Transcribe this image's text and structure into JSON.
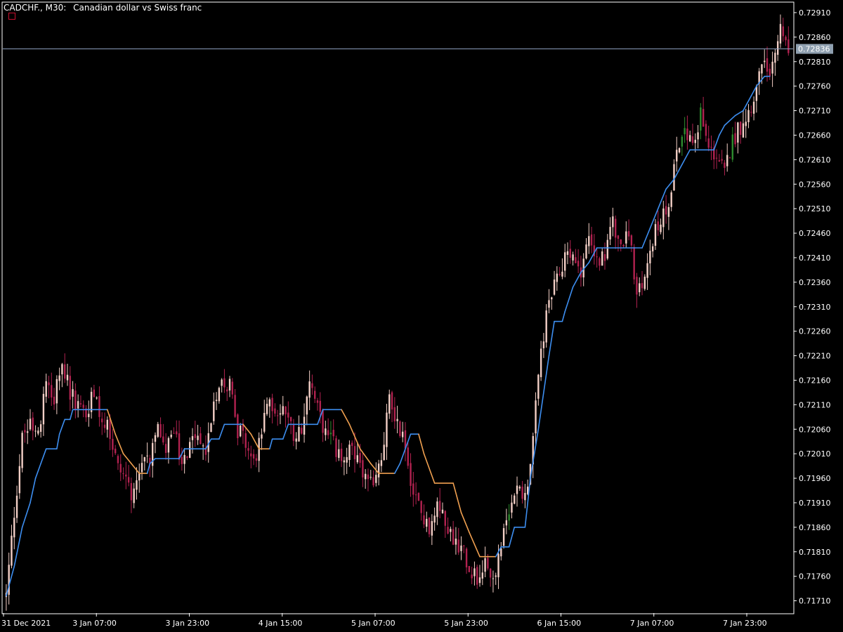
{
  "header": {
    "symbol": "CADCHF., M30:",
    "description": "Canadian dollar vs Swiss franc"
  },
  "colors": {
    "background": "#000000",
    "axis": "#ffffff",
    "text": "#ffffff",
    "bull_candle": "#f3cfc6",
    "bear_candle": "#b22250",
    "bull_candle_alt": "#2e8b2e",
    "trail_up": "#3d8ef0",
    "trail_down": "#f0a050",
    "price_line": "#8fa0c0",
    "price_label_bg": "#8fa0b0",
    "marker": "#c8102e"
  },
  "icons": {
    "marker": "square-icon"
  },
  "current_price": {
    "value": 0.72836,
    "label": "0.72836"
  },
  "chart_data": {
    "type": "candlestick",
    "title": "CADCHF., M30:  Canadian dollar vs Swiss franc",
    "ylim": [
      0.71685,
      0.7293
    ],
    "y_ticks": [
      "0.72910",
      "0.72860",
      "0.72810",
      "0.72760",
      "0.72710",
      "0.72660",
      "0.72610",
      "0.72560",
      "0.72510",
      "0.72460",
      "0.72410",
      "0.72360",
      "0.72310",
      "0.72260",
      "0.72210",
      "0.72160",
      "0.72110",
      "0.72060",
      "0.72010",
      "0.71960",
      "0.71910",
      "0.71860",
      "0.71810",
      "0.71760",
      "0.71710"
    ],
    "x_ticks": [
      "31 Dec 2021",
      "3 Jan 07:00",
      "3 Jan 23:00",
      "4 Jan 15:00",
      "5 Jan 07:00",
      "5 Jan 23:00",
      "6 Jan 15:00",
      "7 Jan 07:00",
      "7 Jan 23:00"
    ],
    "close_path": [
      [
        0,
        0.7172
      ],
      [
        3,
        0.7189
      ],
      [
        6,
        0.7204
      ],
      [
        9,
        0.7208
      ],
      [
        12,
        0.7206
      ],
      [
        15,
        0.7215
      ],
      [
        18,
        0.7213
      ],
      [
        21,
        0.7219
      ],
      [
        24,
        0.7214
      ],
      [
        27,
        0.7211
      ],
      [
        30,
        0.7209
      ],
      [
        33,
        0.7214
      ],
      [
        36,
        0.7208
      ],
      [
        39,
        0.7205
      ],
      [
        42,
        0.7198
      ],
      [
        45,
        0.7196
      ],
      [
        48,
        0.7192
      ],
      [
        51,
        0.7198
      ],
      [
        54,
        0.72
      ],
      [
        57,
        0.7206
      ],
      [
        60,
        0.7203
      ],
      [
        63,
        0.7205
      ],
      [
        66,
        0.7199
      ],
      [
        69,
        0.7202
      ],
      [
        72,
        0.7204
      ],
      [
        75,
        0.7201
      ],
      [
        78,
        0.7212
      ],
      [
        81,
        0.7217
      ],
      [
        84,
        0.7215
      ],
      [
        87,
        0.7206
      ],
      [
        90,
        0.7203
      ],
      [
        93,
        0.7199
      ],
      [
        96,
        0.7205
      ],
      [
        99,
        0.7213
      ],
      [
        102,
        0.7209
      ],
      [
        105,
        0.721
      ],
      [
        108,
        0.7205
      ],
      [
        111,
        0.7207
      ],
      [
        114,
        0.7216
      ],
      [
        117,
        0.721
      ],
      [
        120,
        0.7205
      ],
      [
        123,
        0.7203
      ],
      [
        126,
        0.7199
      ],
      [
        129,
        0.7202
      ],
      [
        132,
        0.7199
      ],
      [
        135,
        0.7196
      ],
      [
        138,
        0.7194
      ],
      [
        141,
        0.72
      ],
      [
        144,
        0.7212
      ],
      [
        147,
        0.7207
      ],
      [
        150,
        0.7203
      ],
      [
        153,
        0.7193
      ],
      [
        156,
        0.7189
      ],
      [
        159,
        0.7185
      ],
      [
        162,
        0.7192
      ],
      [
        165,
        0.7188
      ],
      [
        168,
        0.7184
      ],
      [
        171,
        0.7182
      ],
      [
        174,
        0.7178
      ],
      [
        177,
        0.7176
      ],
      [
        180,
        0.718
      ],
      [
        183,
        0.7174
      ],
      [
        186,
        0.7183
      ],
      [
        189,
        0.7188
      ],
      [
        192,
        0.7196
      ],
      [
        195,
        0.7192
      ],
      [
        198,
        0.7204
      ],
      [
        201,
        0.7222
      ],
      [
        204,
        0.7232
      ],
      [
        207,
        0.7236
      ],
      [
        210,
        0.7242
      ],
      [
        213,
        0.7241
      ],
      [
        216,
        0.7238
      ],
      [
        219,
        0.7246
      ],
      [
        222,
        0.724
      ],
      [
        225,
        0.7241
      ],
      [
        228,
        0.7248
      ],
      [
        231,
        0.7244
      ],
      [
        234,
        0.7247
      ],
      [
        237,
        0.7233
      ],
      [
        240,
        0.7236
      ],
      [
        243,
        0.7245
      ],
      [
        246,
        0.7248
      ],
      [
        249,
        0.7252
      ],
      [
        252,
        0.7264
      ],
      [
        255,
        0.7267
      ],
      [
        258,
        0.7264
      ],
      [
        261,
        0.727
      ],
      [
        264,
        0.7263
      ],
      [
        267,
        0.7262
      ],
      [
        270,
        0.7258
      ],
      [
        273,
        0.7265
      ],
      [
        276,
        0.7268
      ],
      [
        279,
        0.7271
      ],
      [
        282,
        0.7276
      ],
      [
        285,
        0.7281
      ],
      [
        288,
        0.7279
      ],
      [
        291,
        0.7288
      ],
      [
        294,
        0.72836
      ]
    ],
    "trail_path": [
      [
        0,
        0.7172
      ],
      [
        3,
        0.7178
      ],
      [
        6,
        0.7186
      ],
      [
        9,
        0.7191
      ],
      [
        11,
        0.7196
      ],
      [
        13,
        0.7199
      ],
      [
        15,
        0.7202
      ],
      [
        19,
        0.7202
      ],
      [
        20,
        0.7205
      ],
      [
        22,
        0.7208
      ],
      [
        24,
        0.7208
      ],
      [
        25,
        0.721
      ],
      [
        38,
        0.721
      ],
      [
        41,
        0.7205
      ],
      [
        44,
        0.7201
      ],
      [
        47,
        0.7199
      ],
      [
        50,
        0.7197
      ],
      [
        53,
        0.7197
      ],
      [
        54,
        0.7199
      ],
      [
        56,
        0.72
      ],
      [
        65,
        0.72
      ],
      [
        67,
        0.7202
      ],
      [
        75,
        0.7202
      ],
      [
        77,
        0.7204
      ],
      [
        80,
        0.7204
      ],
      [
        82,
        0.7207
      ],
      [
        89,
        0.7207
      ],
      [
        92,
        0.7205
      ],
      [
        95,
        0.7202
      ],
      [
        99,
        0.7202
      ],
      [
        100,
        0.7204
      ],
      [
        104,
        0.7204
      ],
      [
        106,
        0.7207
      ],
      [
        117,
        0.7207
      ],
      [
        119,
        0.721
      ],
      [
        126,
        0.721
      ],
      [
        129,
        0.7207
      ],
      [
        133,
        0.7202
      ],
      [
        137,
        0.7199
      ],
      [
        140,
        0.7197
      ],
      [
        146,
        0.7197
      ],
      [
        148,
        0.7199
      ],
      [
        150,
        0.7202
      ],
      [
        152,
        0.7205
      ],
      [
        155,
        0.7205
      ],
      [
        157,
        0.7201
      ],
      [
        161,
        0.7195
      ],
      [
        168,
        0.7195
      ],
      [
        171,
        0.7189
      ],
      [
        174,
        0.7185
      ],
      [
        178,
        0.718
      ],
      [
        184,
        0.718
      ],
      [
        186,
        0.7182
      ],
      [
        189,
        0.7182
      ],
      [
        191,
        0.7186
      ],
      [
        195,
        0.7186
      ],
      [
        197,
        0.7196
      ],
      [
        200,
        0.7206
      ],
      [
        204,
        0.7221
      ],
      [
        206,
        0.7228
      ],
      [
        209,
        0.7228
      ],
      [
        210,
        0.723
      ],
      [
        213,
        0.7235
      ],
      [
        216,
        0.7238
      ],
      [
        219,
        0.724
      ],
      [
        222,
        0.7243
      ],
      [
        239,
        0.7243
      ],
      [
        242,
        0.7247
      ],
      [
        245,
        0.7251
      ],
      [
        248,
        0.7255
      ],
      [
        251,
        0.7257
      ],
      [
        254,
        0.726
      ],
      [
        257,
        0.7263
      ],
      [
        266,
        0.7263
      ],
      [
        268,
        0.7266
      ],
      [
        270,
        0.7268
      ],
      [
        274,
        0.727
      ],
      [
        277,
        0.7271
      ],
      [
        280,
        0.7274
      ],
      [
        282,
        0.7276
      ],
      [
        285,
        0.7278
      ],
      [
        287,
        0.7278
      ]
    ],
    "series": [
      {
        "name": "CADCHF",
        "type": "candlestick"
      },
      {
        "name": "",
        "type": "line"
      }
    ],
    "legend": "none",
    "grid": false
  }
}
